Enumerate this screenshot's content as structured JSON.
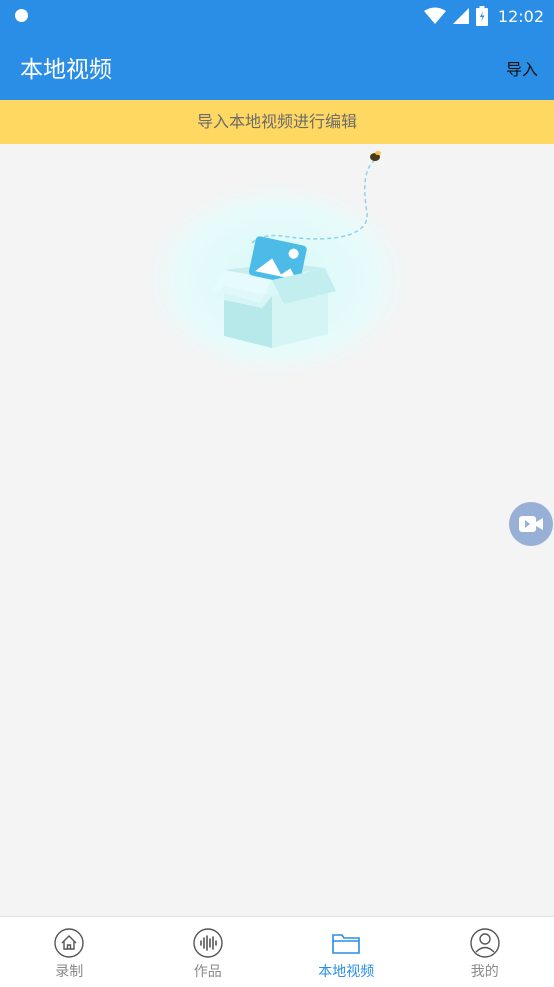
{
  "status_bar": {
    "time": "12:02"
  },
  "header": {
    "title": "本地视频",
    "import_label": "导入"
  },
  "banner": {
    "text": "导入本地视频进行编辑"
  },
  "bottom_nav": {
    "items": [
      {
        "label": "录制",
        "icon": "home-icon",
        "active": false
      },
      {
        "label": "作品",
        "icon": "waveform-icon",
        "active": false
      },
      {
        "label": "本地视频",
        "icon": "folder-icon",
        "active": true
      },
      {
        "label": "我的",
        "icon": "person-icon",
        "active": false
      }
    ]
  },
  "colors": {
    "primary": "#2a8ee6",
    "banner": "#ffd862",
    "background": "#f4f4f4",
    "fab": "#8fa9d3"
  }
}
